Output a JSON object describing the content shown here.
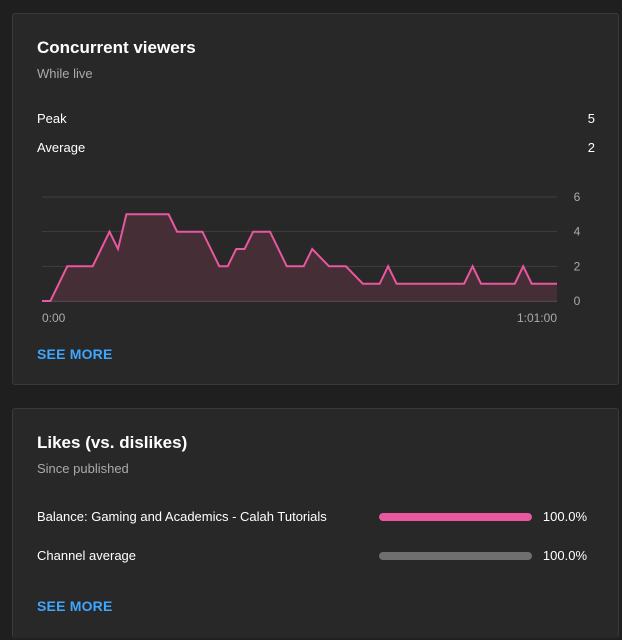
{
  "viewers": {
    "title": "Concurrent viewers",
    "subtitle": "While live",
    "stats": [
      {
        "label": "Peak",
        "value": "5"
      },
      {
        "label": "Average",
        "value": "2"
      }
    ],
    "see_more": "SEE MORE"
  },
  "likes": {
    "title": "Likes (vs. dislikes)",
    "subtitle": "Since published",
    "rows": [
      {
        "label": "Balance: Gaming and Academics - Calah Tutorials",
        "value": "100.0%",
        "fraction": 1.0,
        "color": "#e9579f"
      },
      {
        "label": "Channel average",
        "value": "100.0%",
        "fraction": 1.0,
        "color": "#6f6f6f"
      }
    ],
    "see_more": "SEE MORE"
  },
  "chart_data": {
    "type": "area",
    "xlabel": "",
    "ylabel": "",
    "x_tick_labels": [
      "0:00",
      "1:01:00"
    ],
    "y_ticks": [
      0,
      2,
      4,
      6
    ],
    "ylim": [
      0,
      6
    ],
    "xlim": [
      0,
      61
    ],
    "grid": true,
    "line_color": "#e9579f",
    "fill_color": "#4a2f38",
    "series": [
      {
        "x": [
          0,
          1,
          3,
          6,
          8,
          9,
          10,
          11,
          15,
          16,
          19,
          21,
          22,
          23,
          24,
          25,
          27,
          28,
          29,
          31,
          32,
          34,
          35,
          36,
          38,
          40,
          41,
          42,
          43,
          45,
          47,
          48,
          50,
          51,
          52,
          53,
          54,
          55,
          56,
          57,
          58,
          60,
          61
        ],
        "y": [
          0,
          0,
          2,
          2,
          4,
          3,
          5,
          5,
          5,
          4,
          4,
          2,
          2,
          3,
          3,
          4,
          4,
          3,
          2,
          2,
          3,
          2,
          2,
          2,
          1,
          1,
          2,
          1,
          1,
          1,
          1,
          1,
          1,
          2,
          1,
          1,
          1,
          1,
          1,
          2,
          1,
          1,
          1
        ]
      }
    ]
  }
}
